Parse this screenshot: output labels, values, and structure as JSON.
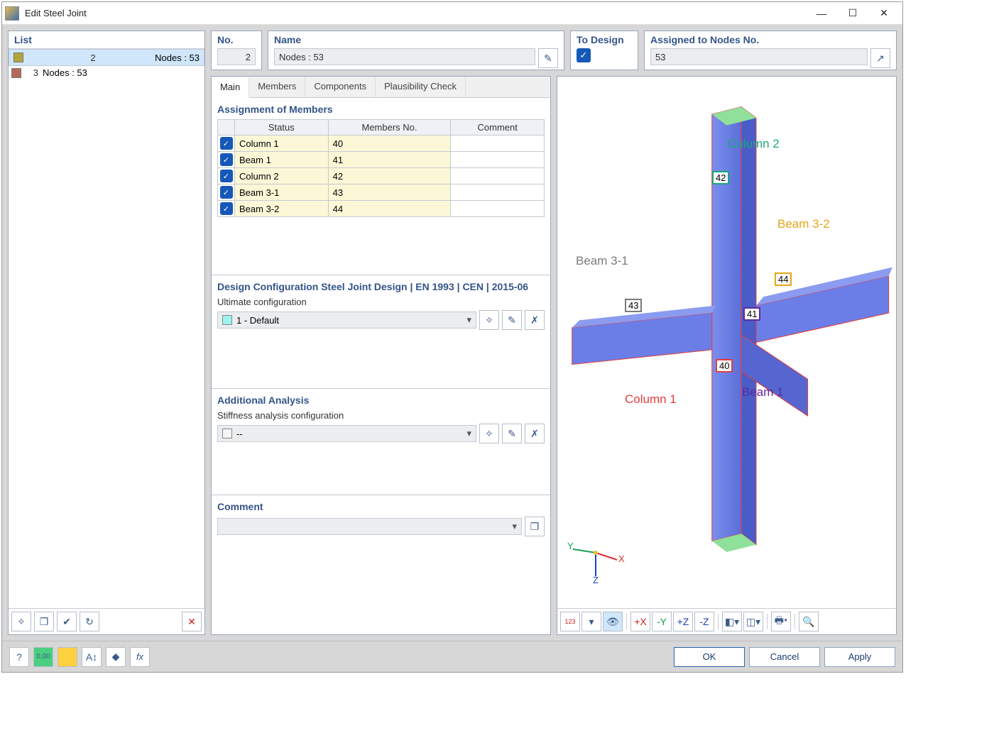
{
  "titlebar": {
    "title": "Edit Steel Joint"
  },
  "list": {
    "header": "List",
    "items": [
      {
        "index": "2",
        "label": "Nodes : 53",
        "color": "#b3a53a",
        "selected": true
      },
      {
        "index": "3",
        "label": "Nodes : 53",
        "color": "#b46a5a",
        "selected": false
      }
    ]
  },
  "header": {
    "no_label": "No.",
    "no_value": "2",
    "name_label": "Name",
    "name_value": "Nodes : 53",
    "to_design_label": "To Design",
    "assigned_label": "Assigned to Nodes No.",
    "assigned_value": "53"
  },
  "tabs": [
    "Main",
    "Members",
    "Components",
    "Plausibility Check"
  ],
  "assignment": {
    "title": "Assignment of Members",
    "cols": [
      "Status",
      "Members No.",
      "Comment"
    ],
    "rows": [
      {
        "status": "Column 1",
        "members": "40"
      },
      {
        "status": "Beam 1",
        "members": "41"
      },
      {
        "status": "Column 2",
        "members": "42"
      },
      {
        "status": "Beam 3-1",
        "members": "43"
      },
      {
        "status": "Beam 3-2",
        "members": "44"
      }
    ]
  },
  "design_config": {
    "title": "Design Configuration Steel Joint Design | EN 1993 | CEN | 2015-06",
    "ultimate_label": "Ultimate configuration",
    "ultimate_value": "1 - Default"
  },
  "additional": {
    "title": "Additional Analysis",
    "stiffness_label": "Stiffness analysis configuration",
    "stiffness_value": "--"
  },
  "comment": {
    "title": "Comment",
    "value": ""
  },
  "viewer": {
    "labels": {
      "col1": {
        "text": "Column 1",
        "color": "#e23d3d"
      },
      "col2": {
        "text": "Column 2",
        "color": "#18a97b"
      },
      "beam1": {
        "text": "Beam 1",
        "color": "#5b2aa0"
      },
      "beam31": {
        "text": "Beam 3-1",
        "color": "#7a7a7a"
      },
      "beam32": {
        "text": "Beam 3-2",
        "color": "#e6a515"
      }
    },
    "nodes": {
      "n40": "40",
      "n41": "41",
      "n42": "42",
      "n43": "43",
      "n44": "44"
    },
    "axes": {
      "x": "X",
      "y": "Y",
      "z": "Z"
    }
  },
  "footer": {
    "ok": "OK",
    "cancel": "Cancel",
    "apply": "Apply"
  }
}
